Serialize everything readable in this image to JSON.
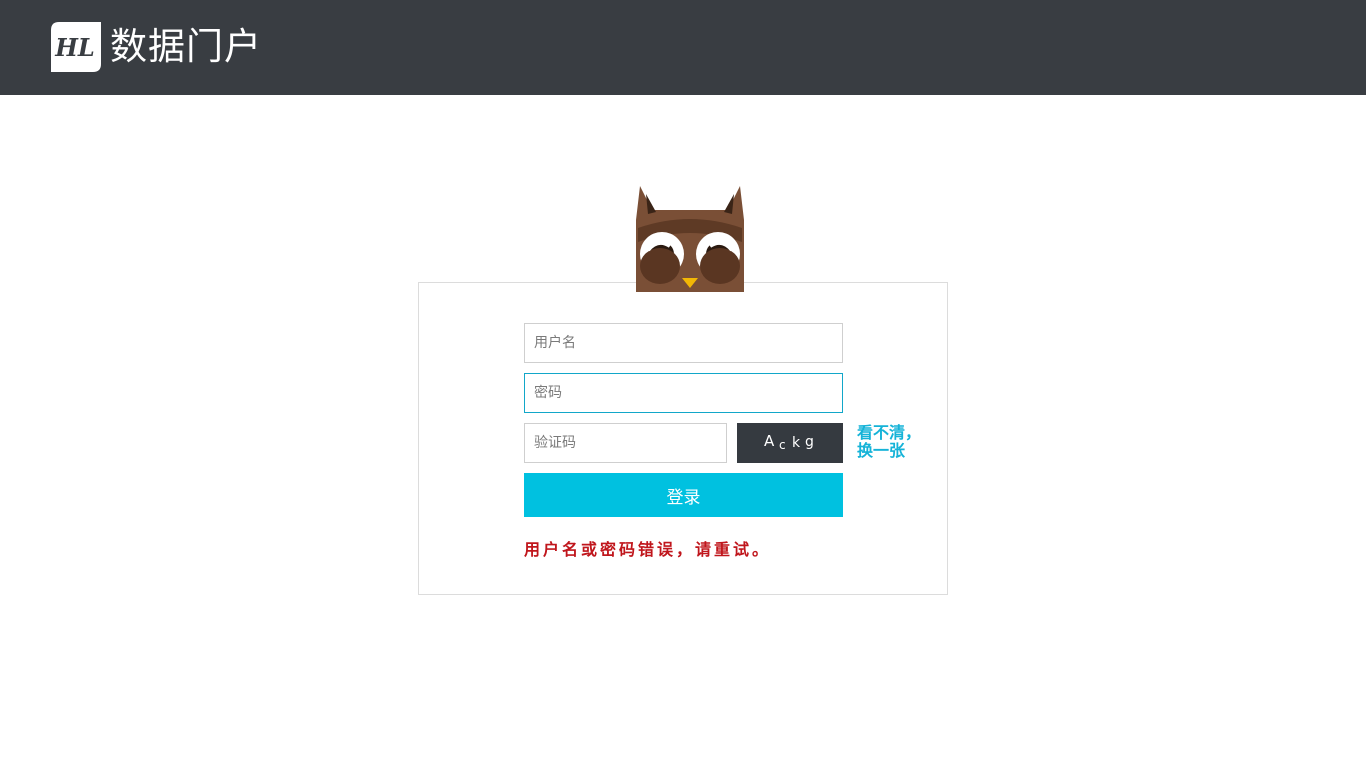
{
  "header": {
    "logo_text": "HL",
    "title": "数据门户"
  },
  "login": {
    "username_placeholder": "用户名",
    "password_placeholder": "密码",
    "captcha_placeholder": "验证码",
    "captcha_chars": [
      "A",
      "c",
      "k",
      "g"
    ],
    "refresh_line1": "看不清，",
    "refresh_line2": "换一张",
    "submit_label": "登录",
    "error_message": "用户名或密码错误，请重试。"
  },
  "colors": {
    "header_bg": "#393d42",
    "accent": "#00c1e0",
    "error": "#c0161c",
    "captcha_bg": "#353a40"
  },
  "icons": {
    "logo": "hl-logo-icon",
    "mascot": "owl-mascot-icon"
  }
}
